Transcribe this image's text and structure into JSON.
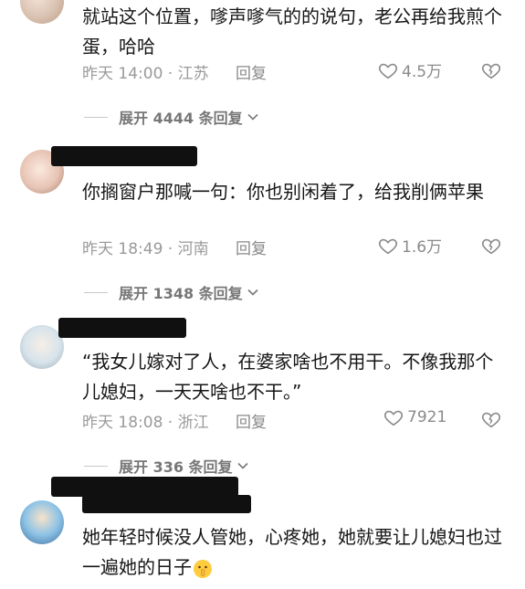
{
  "comments": [
    {
      "text": "就站这个位置，嗲声嗲气的的说句，老公再给我煎个蛋，哈哈",
      "meta": "昨天 14:00 · 江苏",
      "reply": "回复",
      "likes": "4.5万",
      "expand": "展开 4444 条回复"
    },
    {
      "text": "你搁窗户那喊一句：你也别闲着了，给我削俩苹果",
      "meta": "昨天 18:49 · 河南",
      "reply": "回复",
      "likes": "1.6万",
      "expand": "展开 1348 条回复"
    },
    {
      "text": "“我女儿嫁对了人，在婆家啥也不用干。不像我那个儿媳妇，一天天啥也不干。”",
      "meta": "昨天 18:08 · 浙江",
      "reply": "回复",
      "likes": "7921",
      "expand": "展开 336 条回复"
    },
    {
      "text": "她年轻时候没人管她，心疼她，她就要让儿媳妇也过一遍她的日子"
    }
  ],
  "icons": {
    "like": "heart-outline-icon",
    "dislike": "broken-heart-icon",
    "expand": "chevron-down-icon"
  },
  "colors": {
    "meta": "#9a9a9a",
    "text": "#161616"
  }
}
